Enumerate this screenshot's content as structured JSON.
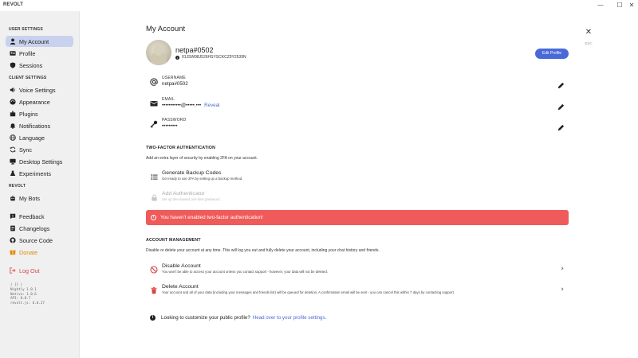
{
  "window": {
    "app_title": "REVOLT",
    "minimize": "—",
    "maximize": "☐",
    "close": "✕"
  },
  "sidebar": {
    "sections": {
      "user_settings": "USER SETTINGS",
      "client_settings": "CLIENT SETTINGS",
      "revolt": "REVOLT"
    },
    "items": [
      {
        "label": "My Account",
        "icon": "user-icon",
        "active": true
      },
      {
        "label": "Profile",
        "icon": "id-card-icon"
      },
      {
        "label": "Sessions",
        "icon": "shield-icon"
      },
      {
        "label": "Voice Settings",
        "icon": "speaker-icon"
      },
      {
        "label": "Appearance",
        "icon": "palette-icon"
      },
      {
        "label": "Plugins",
        "icon": "puzzle-icon"
      },
      {
        "label": "Notifications",
        "icon": "bell-icon"
      },
      {
        "label": "Language",
        "icon": "globe-icon"
      },
      {
        "label": "Sync",
        "icon": "sync-icon"
      },
      {
        "label": "Desktop Settings",
        "icon": "desktop-icon"
      },
      {
        "label": "Experiments",
        "icon": "flask-icon"
      },
      {
        "label": "My Bots",
        "icon": "robot-icon"
      },
      {
        "label": "Feedback",
        "icon": "feedback-icon"
      },
      {
        "label": "Changelogs",
        "icon": "changelog-icon"
      },
      {
        "label": "Source Code",
        "icon": "github-icon"
      },
      {
        "label": "Donate",
        "icon": "donate-icon"
      },
      {
        "label": "Log Out",
        "icon": "logout-icon"
      }
    ],
    "version": {
      "line1": "( {} )",
      "line2": "Nightly 1.0.1",
      "line3": "Netivo: 1.0.6",
      "line4": "API: 0.8.7",
      "line5": "revolt.js: 6.0.27"
    }
  },
  "close_panel": {
    "close_symbol": "✕",
    "esc_label": "ESC"
  },
  "main": {
    "title": "My Account",
    "profile": {
      "name": "netpa#0502",
      "id_prefix": "i",
      "id": "01JSW98J526HSYSCKCZ9Y2539N",
      "edit_button": "Edit Profile"
    },
    "fields": [
      {
        "label": "USERNAME",
        "value": "netpa#0502",
        "icon": "at-icon"
      },
      {
        "label": "EMAIL",
        "value": "•••••••••••@•••••.•••",
        "reveal": "Reveal",
        "icon": "mail-icon"
      },
      {
        "label": "PASSWORD",
        "value": "•••••••••",
        "icon": "key-icon"
      }
    ],
    "two_factor": {
      "title": "TWO-FACTOR AUTHENTICATION",
      "desc": "Add an extra layer of security by enabling 2FA on your account.",
      "options": [
        {
          "title": "Generate Backup Codes",
          "desc": "Get ready to use 2FA by setting up a backup method."
        },
        {
          "title": "Add Authenticator",
          "desc": "Set up time-based one-time password."
        }
      ],
      "alert": "You haven't enabled two-factor authentication!",
      "alert_icon": "!"
    },
    "account_management": {
      "title": "ACCOUNT MANAGEMENT",
      "desc": "Disable or delete your account at any time. This will log you out and fully delete your account, including your chat history and friends.",
      "options": [
        {
          "title": "Disable Account",
          "desc": "You won't be able to access your account unless you contact support - however, your data will not be deleted."
        },
        {
          "title": "Delete Account",
          "desc": "Your account and all of your data (including your messages and friends list) will be queued for deletion. A confirmation email will be sent - you can cancel this within 7 days by contacting support."
        }
      ],
      "chevron": "›"
    },
    "footer": {
      "icon": "i",
      "text": "Looking to customize your public profile?",
      "link": "Head over to your profile settings."
    }
  },
  "colors": {
    "accent": "#4a69d9",
    "danger": "#ef5a5a",
    "donate": "#e08a00",
    "sidebar_bg": "#f0f0f0",
    "active_bg": "#c8d2ee"
  }
}
